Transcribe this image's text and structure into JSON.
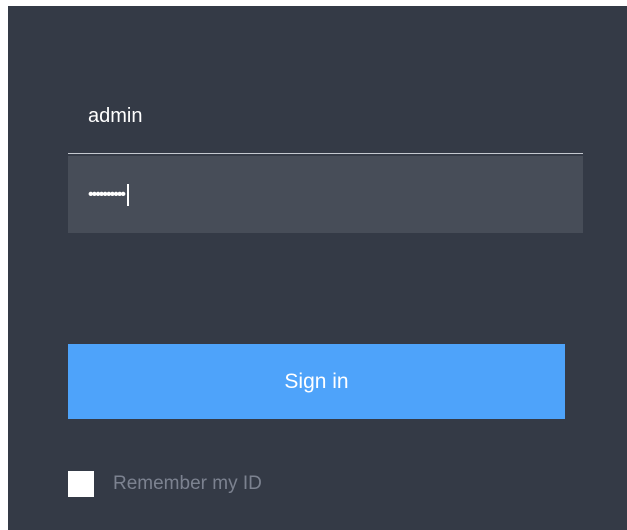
{
  "login": {
    "username_value": "admin",
    "password_mask": "••••••••••",
    "sign_in_label": "Sign in",
    "remember_label": "Remember my ID",
    "remember_checked": false
  },
  "colors": {
    "panel_bg": "#343a46",
    "field_bg": "#474d58",
    "accent": "#4ea3fa",
    "muted_text": "#7c8290"
  }
}
